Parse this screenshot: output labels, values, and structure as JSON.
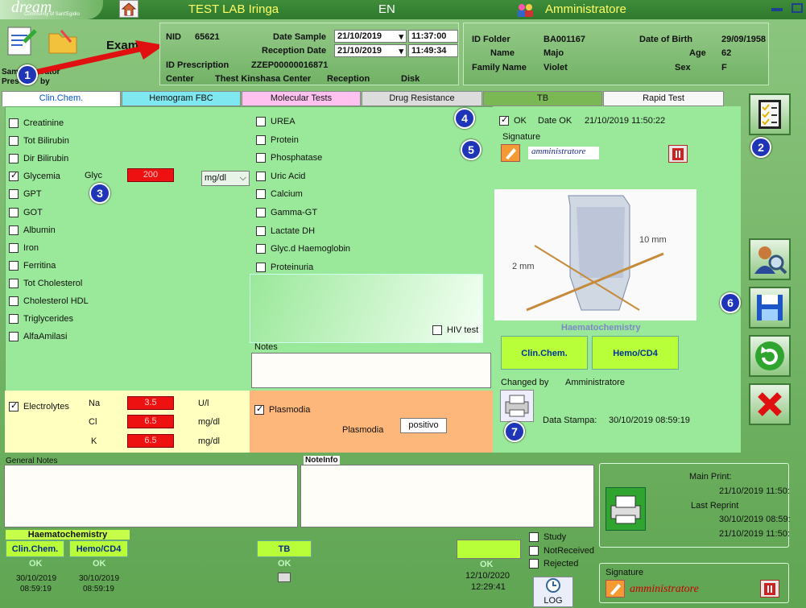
{
  "header": {
    "logo_text": "dream",
    "logo_sub": "Community of Sant'Egidio",
    "lab_title": "TEST LAB Iringa",
    "lang": "EN",
    "user": "Amministratore"
  },
  "exam_panel": {
    "title": "Exam",
    "partial_label_1": "Sam",
    "partial_label_2": "istrator",
    "partial_label_3": "Pres",
    "partial_label_4": "by"
  },
  "sample": {
    "nid_label": "NID",
    "nid": "65621",
    "date_sample_label": "Date Sample",
    "date_sample": "21/10/2019",
    "time_sample": "11:37:00",
    "reception_date_label": "Reception Date",
    "reception_date": "21/10/2019",
    "reception_time": "11:49:34",
    "id_prescription_label": "ID Prescription",
    "id_prescription": "ZZEP00000016871",
    "center_label": "Center",
    "center": "Thest Kinshasa Center",
    "reception_label": "Reception",
    "reception": "Disk"
  },
  "patient": {
    "id_folder_label": "ID Folder",
    "id_folder": "BA001167",
    "dob_label": "Date of Birth",
    "dob": "29/09/1958",
    "name_label": "Name",
    "name": "Majo",
    "age_label": "Age",
    "age": "62",
    "family_label": "Family Name",
    "family": "Violet",
    "sex_label": "Sex",
    "sex": "F"
  },
  "tabs": [
    {
      "label": "Clin.Chem.",
      "color": "#ffffff",
      "text": "#0055cc"
    },
    {
      "label": "Hemogram FBC",
      "color": "#7fe7ef"
    },
    {
      "label": "Molecular Tests",
      "color": "#ffc2f0"
    },
    {
      "label": "Drug Resistance",
      "color": "#dcdcdc"
    },
    {
      "label": "TB",
      "color": "#7ab854"
    },
    {
      "label": "Rapid Test",
      "color": "#f7f7f7"
    }
  ],
  "tests_col1": [
    "Creatinine",
    "Tot Bilirubin",
    "Dir Bilirubin",
    "Glycemia",
    "GPT",
    "GOT",
    "Albumin",
    "Iron",
    "Ferritina",
    "Tot Cholesterol",
    "Cholesterol HDL",
    "Triglycerides",
    "AlfaAmilasi"
  ],
  "glyc": {
    "label": "Glyc",
    "value": "200",
    "unit": "mg/dl"
  },
  "tests_col2": [
    "UREA",
    "Protein",
    "Phosphatase",
    "Uric Acid",
    "Calcium",
    "Gamma-GT",
    "Lactate DH",
    "Glyc.d Haemoglobin",
    "Proteinuria"
  ],
  "hiv_label": "HIV test",
  "notes_label": "Notes",
  "ok": {
    "label": "OK",
    "date_label": "Date OK",
    "date": "21/10/2019 11:50:22",
    "signature_label": "Signature",
    "signature": "amministratore"
  },
  "image_caption": "Haematochemistry",
  "img_labels": {
    "a": "10 mm",
    "b": "2 mm"
  },
  "buttons": {
    "clin": "Clin.Chem.",
    "hemo": "Hemo/CD4"
  },
  "changed": {
    "label": "Changed by",
    "value": "Amministratore"
  },
  "print": {
    "label": "Data Stampa:",
    "value": "30/10/2019 08:59:19"
  },
  "electrolytes": {
    "label": "Electrolytes",
    "rows": [
      {
        "name": "Na",
        "value": "3.5",
        "unit": "U/l"
      },
      {
        "name": "Cl",
        "value": "6.5",
        "unit": "mg/dl"
      },
      {
        "name": "K",
        "value": "6.5",
        "unit": "mg/dl"
      }
    ]
  },
  "plasmodia": {
    "label": "Plasmodia",
    "field_label": "Plasmodia",
    "value": "positivo"
  },
  "general_notes_label": "General Notes",
  "noteinfo_label": "NoteInfo",
  "bottom": {
    "haem_title": "Haematochemistry",
    "clin": "Clin.Chem.",
    "hemo": "Hemo/CD4",
    "tb": "TB",
    "ok": "OK",
    "date1": "30/10/2019",
    "time1": "08:59:19",
    "date2": "30/10/2019",
    "time2": "08:59:19",
    "date3": "12/10/2020",
    "time3": "12:29:41",
    "log": "LOG",
    "study": "Study",
    "not_received": "NotReceived",
    "rejected": "Rejected"
  },
  "print_info": {
    "main_label": "Main Print:",
    "main_value": "21/10/2019 11:50:",
    "reprint_label": "Last Reprint",
    "reprint_value1": "30/10/2019 08:59:",
    "reprint_value2": "21/10/2019 11:50:"
  },
  "bottom_signature": {
    "label": "Signature",
    "value": "amministratore"
  },
  "badges": [
    "1",
    "2",
    "3",
    "4",
    "5",
    "6",
    "7"
  ]
}
